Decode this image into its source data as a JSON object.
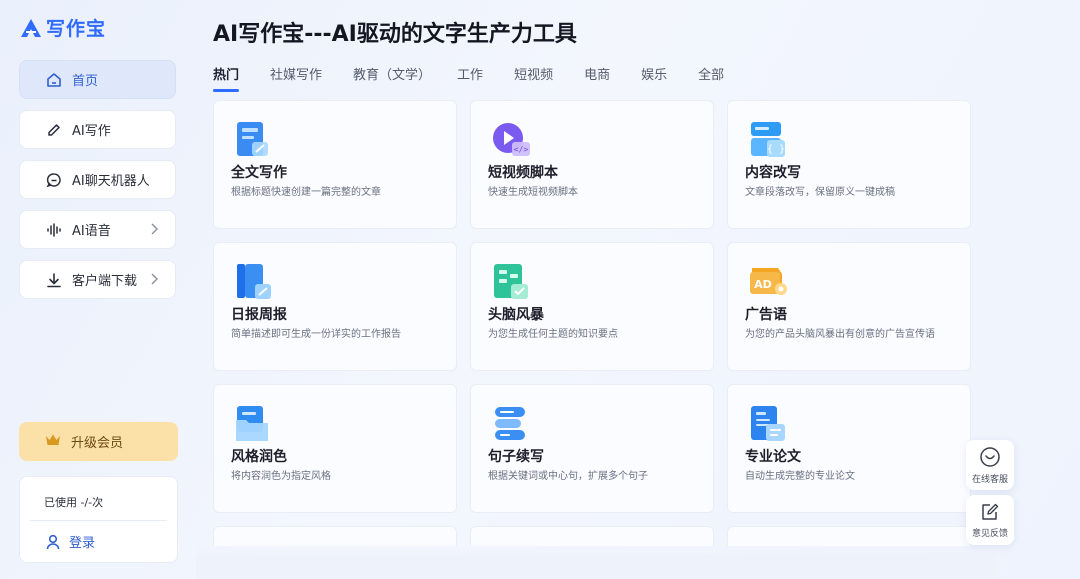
{
  "app": {
    "logo_text": "写作宝",
    "page_title": "AI写作宝---AI驱动的文字生产力工具"
  },
  "sidebar": {
    "items": [
      {
        "label": "首页",
        "icon": "home-icon",
        "active": true
      },
      {
        "label": "AI写作",
        "icon": "pen-icon"
      },
      {
        "label": "AI聊天机器人",
        "icon": "chat-icon"
      },
      {
        "label": "AI语音",
        "icon": "voice-icon",
        "has_arrow": true
      },
      {
        "label": "客户端下载",
        "icon": "download-icon",
        "has_arrow": true
      }
    ],
    "upgrade_label": "升级会员",
    "usage_text": "已使用 -/-次",
    "login_label": "登录"
  },
  "tabs": [
    {
      "label": "热门",
      "active": true
    },
    {
      "label": "社媒写作"
    },
    {
      "label": "教育（文学）"
    },
    {
      "label": "工作"
    },
    {
      "label": "短视频"
    },
    {
      "label": "电商"
    },
    {
      "label": "娱乐"
    },
    {
      "label": "全部"
    }
  ],
  "cards": [
    {
      "title": "全文写作",
      "desc": "根据标题快速创建一篇完整的文章",
      "icon": "document-write-icon"
    },
    {
      "title": "短视频脚本",
      "desc": "快速生成短视频脚本",
      "icon": "video-script-icon"
    },
    {
      "title": "内容改写",
      "desc": "文章段落改写，保留原义一键成稿",
      "icon": "rewrite-icon"
    },
    {
      "title": "日报周报",
      "desc": "简单描述即可生成一份详实的工作报告",
      "icon": "report-icon"
    },
    {
      "title": "头脑风暴",
      "desc": "为您生成任何主题的知识要点",
      "icon": "brainstorm-icon"
    },
    {
      "title": "广告语",
      "desc": "为您的产品头脑风暴出有创意的广告宣传语",
      "icon": "ad-icon"
    },
    {
      "title": "风格润色",
      "desc": "将内容润色为指定风格",
      "icon": "style-polish-icon"
    },
    {
      "title": "句子续写",
      "desc": "根据关键词或中心句，扩展多个句子",
      "icon": "sentence-continue-icon"
    },
    {
      "title": "专业论文",
      "desc": "自动生成完整的专业论文",
      "icon": "paper-icon"
    }
  ],
  "float": {
    "service_label": "在线客服",
    "feedback_label": "意见反馈"
  },
  "colors": {
    "accent": "#2f6bff",
    "upgrade_bg": "#fbe0a8"
  }
}
